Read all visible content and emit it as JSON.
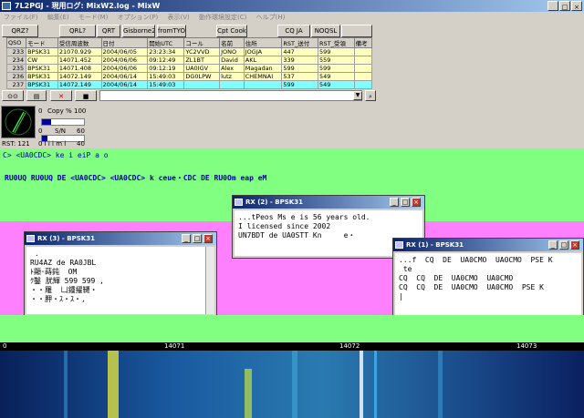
{
  "window": {
    "title": "7L2PGJ - 現用ログ: MixW2.log - MixW"
  },
  "menu": [
    "ファイル(F)",
    "編集(E)",
    "モード(M)",
    "オプション(P)",
    "表示(V)",
    "動作環境設定(C)",
    "ヘルプ(H)"
  ],
  "macros": [
    "QRZ?",
    "QRL?",
    "QRT",
    "Gisborne2",
    "fromTYO",
    "Cpt Cook",
    "CQ JA",
    "NOQSL"
  ],
  "log": {
    "headers": [
      "QSO",
      "モード",
      "受信周波数",
      "日付",
      "開始UTC",
      "コール",
      "名前",
      "住所",
      "RST_送付",
      "RST_受領",
      "備考"
    ],
    "rows": [
      [
        "233",
        "BPSK31",
        "21070.929",
        "2004/06/05",
        "23:23:34",
        "YC2VVD",
        "JONO",
        "JOGJA",
        "447",
        "599",
        ""
      ],
      [
        "234",
        "CW",
        "14071.452",
        "2004/06/06",
        "09:12:49",
        "ZL1BT",
        "David",
        "AKL",
        "339",
        "559",
        ""
      ],
      [
        "235",
        "BPSK31",
        "14071.408",
        "2004/06/06",
        "09:12:19",
        "UA0IGV",
        "Alex",
        "Magadan",
        "599",
        "599",
        ""
      ],
      [
        "236",
        "BPSK31",
        "14072.149",
        "2004/06/14",
        "15:49:03",
        "DG0LPW",
        "lutz",
        "CHEMNAI",
        "537",
        "549",
        ""
      ],
      [
        "237",
        "BPSK31",
        "14072.149",
        "2004/06/14",
        "15:49:03",
        "",
        "",
        "",
        "599",
        "549",
        ""
      ]
    ]
  },
  "indicators": {
    "copy_label": "Copy %",
    "copy_max": "100",
    "copy_zero": "0",
    "sn_label": "S/N",
    "sn_zero": "0",
    "sn_max": "60",
    "level_label": "0 l i l m l",
    "level_max": "40",
    "rst": "RST: 121"
  },
  "rx_main": {
    "line1": "C> <UA0CDC> ke   i eiP  a   o",
    "line2": "RU0UQ  RU0UQ DE <UA0CDC> <UA0CDC> k  ceue・CDC  DE RU0Om eap  eM"
  },
  "windows": [
    {
      "title": "RX (2) - BPSK31",
      "text": "...tPeos Ms e is 56 years old.\nI licensed since 2002\nUN7BDT de UA0STT Kn     e・"
    },
    {
      "title": "RX (3) - BPSK31",
      "text": " .\nRU4AZ de RA0JBL\nﾄ顯･蒔鈍  OM\nｸ鑿 肬輝 599 599 ,\n・・羅  凵鍾擢韆・\n・・胛・ｽ・ｽ・,"
    },
    {
      "title": "RX (1) - BPSK31",
      "text": "...f  CQ  DE  UA0CMO  UA0CMO  PSE K\n te\nCQ  CQ  DE  UA0CMO  UA0CMO\nCQ  CQ  DE  UA0CMO  UA0CMO  PSE K\n|"
    }
  ],
  "scale": [
    "0",
    "14071",
    "14072",
    "14073"
  ],
  "colors": {
    "rx_main": "#80ff80",
    "rx_pink": "#ff80ff",
    "waterfall": "#0a2a6a"
  }
}
